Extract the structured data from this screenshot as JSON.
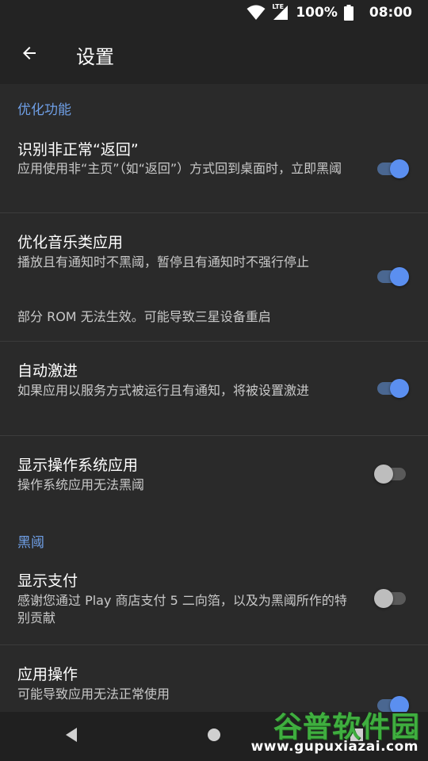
{
  "status_bar": {
    "network": "LTE",
    "battery": "100%",
    "time": "08:00"
  },
  "app_bar": {
    "title": "设置"
  },
  "sections": {
    "optimization": {
      "header": "优化功能",
      "items": [
        {
          "title": "识别非正常“返回”",
          "summary": "应用使用非“主页”（如“返回”）方式回到桌面时，立即黑阈",
          "enabled": true
        },
        {
          "title": "优化音乐类应用",
          "summary": "播放且有通知时不黑阈，暂停且有通知时不强行停止",
          "note": "部分 ROM 无法生效。可能导致三星设备重启",
          "enabled": true
        },
        {
          "title": "自动激进",
          "summary": "如果应用以服务方式被运行且有通知，将被设置激进",
          "enabled": true
        },
        {
          "title": "显示操作系统应用",
          "summary": "操作系统应用无法黑阈",
          "enabled": false
        }
      ]
    },
    "heiyu": {
      "header": "黑阈",
      "items": [
        {
          "title": "显示支付",
          "summary": "感谢您通过 Play 商店支付 5 二向箔，以及为黑阈所作的特别贡献",
          "enabled": false
        },
        {
          "title": "应用操作",
          "summary": "可能导致应用无法正常使用",
          "enabled": true
        }
      ]
    }
  },
  "watermark": {
    "logo": "谷普软件园",
    "url": "www.gupuxiazai.com"
  },
  "icons": {
    "back": "arrow-back-icon",
    "wifi": "wifi-icon",
    "signal": "signal-icon",
    "battery": "battery-icon",
    "nav_back": "nav-back-icon",
    "nav_home": "nav-home-icon",
    "nav_recents": "nav-recents-icon"
  },
  "colors": {
    "background": "#2a2a2a",
    "app_bar": "#232323",
    "accent": "#5b8ff0",
    "section_header": "#6f9fe6",
    "divider": "#3c3c3c"
  }
}
